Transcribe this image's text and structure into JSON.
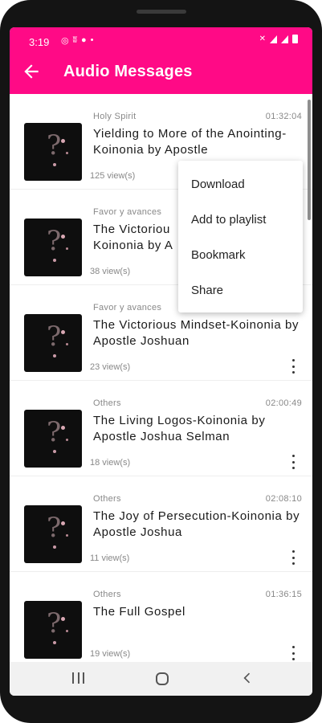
{
  "status": {
    "time": "3:19",
    "left_icons": [
      "whatsapp-icon",
      "at-icon",
      "messenger-icon",
      "dot-icon"
    ],
    "right_icons": [
      "mute-icon",
      "wifi-signal-icon",
      "signal-icon",
      "battery-icon"
    ]
  },
  "header": {
    "title": "Audio Messages",
    "back_icon": "arrow-left-icon",
    "background": "#ff0a86"
  },
  "items": [
    {
      "category": "Holy Spirit",
      "duration": "01:32:04",
      "title": "Yielding to More of the Anointing-Koinonia by Apostle",
      "views": "125 view(s)"
    },
    {
      "category": "Favor y avances",
      "duration": "",
      "title": "The Victoriou Koinonia by A",
      "views": "38 view(s)"
    },
    {
      "category": "Favor y avances",
      "duration": "",
      "title": "The Victorious Mindset-Koinonia by Apostle Joshuan",
      "views": "23 view(s)"
    },
    {
      "category": "Others",
      "duration": "02:00:49",
      "title": "The Living Logos-Koinonia by Apostle Joshua Selman",
      "views": "18 view(s)"
    },
    {
      "category": "Others",
      "duration": "02:08:10",
      "title": "The Joy of Persecution-Koinonia by Apostle Joshua",
      "views": "11 view(s)"
    },
    {
      "category": "Others",
      "duration": "01:36:15",
      "title": "The Full Gospel",
      "views": "19 view(s)"
    }
  ],
  "menu": {
    "items": [
      "Download",
      "Add to playlist",
      "Bookmark",
      "Share"
    ]
  },
  "navbar": {
    "icons": [
      "recent-apps-icon",
      "home-icon",
      "back-icon"
    ]
  }
}
